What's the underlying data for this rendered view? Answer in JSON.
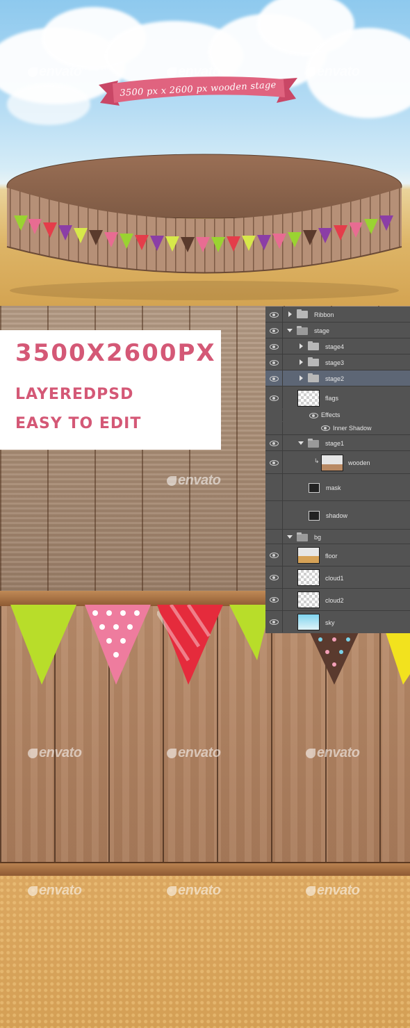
{
  "banner": {
    "ribbon_text": "3500 px x 2600 px wooden stage",
    "watermark": "envato"
  },
  "promo": {
    "size": "3500X2600PX",
    "line1": "LAYEREDPSD",
    "line2": "EASY TO EDIT"
  },
  "layers_panel": {
    "rows": [
      {
        "label": "Ribbon"
      },
      {
        "label": "stage"
      },
      {
        "label": "stage4"
      },
      {
        "label": "stage3"
      },
      {
        "label": "stage2"
      },
      {
        "label": "flags"
      },
      {
        "label": "Effects"
      },
      {
        "label": "Inner Shadow"
      },
      {
        "label": "stage1"
      },
      {
        "label": "wooden"
      },
      {
        "label": "mask"
      },
      {
        "label": "shadow"
      },
      {
        "label": "bg"
      },
      {
        "label": "floor"
      },
      {
        "label": "cloud1"
      },
      {
        "label": "cloud2"
      },
      {
        "label": "sky"
      }
    ]
  },
  "colors": {
    "accent_pink": "#d45876",
    "panel_bg": "#535353",
    "selected_row": "#5d6675"
  }
}
